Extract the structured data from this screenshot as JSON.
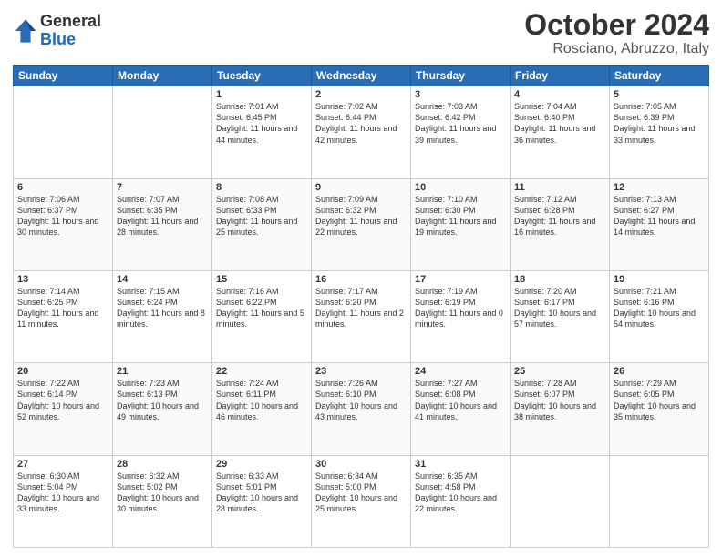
{
  "logo": {
    "general": "General",
    "blue": "Blue"
  },
  "header": {
    "month": "October 2024",
    "location": "Rosciano, Abruzzo, Italy"
  },
  "weekdays": [
    "Sunday",
    "Monday",
    "Tuesday",
    "Wednesday",
    "Thursday",
    "Friday",
    "Saturday"
  ],
  "weeks": [
    [
      {
        "day": "",
        "empty": true
      },
      {
        "day": "",
        "empty": true
      },
      {
        "day": "1",
        "sunrise": "Sunrise: 7:01 AM",
        "sunset": "Sunset: 6:45 PM",
        "daylight": "Daylight: 11 hours and 44 minutes."
      },
      {
        "day": "2",
        "sunrise": "Sunrise: 7:02 AM",
        "sunset": "Sunset: 6:44 PM",
        "daylight": "Daylight: 11 hours and 42 minutes."
      },
      {
        "day": "3",
        "sunrise": "Sunrise: 7:03 AM",
        "sunset": "Sunset: 6:42 PM",
        "daylight": "Daylight: 11 hours and 39 minutes."
      },
      {
        "day": "4",
        "sunrise": "Sunrise: 7:04 AM",
        "sunset": "Sunset: 6:40 PM",
        "daylight": "Daylight: 11 hours and 36 minutes."
      },
      {
        "day": "5",
        "sunrise": "Sunrise: 7:05 AM",
        "sunset": "Sunset: 6:39 PM",
        "daylight": "Daylight: 11 hours and 33 minutes."
      }
    ],
    [
      {
        "day": "6",
        "sunrise": "Sunrise: 7:06 AM",
        "sunset": "Sunset: 6:37 PM",
        "daylight": "Daylight: 11 hours and 30 minutes."
      },
      {
        "day": "7",
        "sunrise": "Sunrise: 7:07 AM",
        "sunset": "Sunset: 6:35 PM",
        "daylight": "Daylight: 11 hours and 28 minutes."
      },
      {
        "day": "8",
        "sunrise": "Sunrise: 7:08 AM",
        "sunset": "Sunset: 6:33 PM",
        "daylight": "Daylight: 11 hours and 25 minutes."
      },
      {
        "day": "9",
        "sunrise": "Sunrise: 7:09 AM",
        "sunset": "Sunset: 6:32 PM",
        "daylight": "Daylight: 11 hours and 22 minutes."
      },
      {
        "day": "10",
        "sunrise": "Sunrise: 7:10 AM",
        "sunset": "Sunset: 6:30 PM",
        "daylight": "Daylight: 11 hours and 19 minutes."
      },
      {
        "day": "11",
        "sunrise": "Sunrise: 7:12 AM",
        "sunset": "Sunset: 6:28 PM",
        "daylight": "Daylight: 11 hours and 16 minutes."
      },
      {
        "day": "12",
        "sunrise": "Sunrise: 7:13 AM",
        "sunset": "Sunset: 6:27 PM",
        "daylight": "Daylight: 11 hours and 14 minutes."
      }
    ],
    [
      {
        "day": "13",
        "sunrise": "Sunrise: 7:14 AM",
        "sunset": "Sunset: 6:25 PM",
        "daylight": "Daylight: 11 hours and 11 minutes."
      },
      {
        "day": "14",
        "sunrise": "Sunrise: 7:15 AM",
        "sunset": "Sunset: 6:24 PM",
        "daylight": "Daylight: 11 hours and 8 minutes."
      },
      {
        "day": "15",
        "sunrise": "Sunrise: 7:16 AM",
        "sunset": "Sunset: 6:22 PM",
        "daylight": "Daylight: 11 hours and 5 minutes."
      },
      {
        "day": "16",
        "sunrise": "Sunrise: 7:17 AM",
        "sunset": "Sunset: 6:20 PM",
        "daylight": "Daylight: 11 hours and 2 minutes."
      },
      {
        "day": "17",
        "sunrise": "Sunrise: 7:19 AM",
        "sunset": "Sunset: 6:19 PM",
        "daylight": "Daylight: 11 hours and 0 minutes."
      },
      {
        "day": "18",
        "sunrise": "Sunrise: 7:20 AM",
        "sunset": "Sunset: 6:17 PM",
        "daylight": "Daylight: 10 hours and 57 minutes."
      },
      {
        "day": "19",
        "sunrise": "Sunrise: 7:21 AM",
        "sunset": "Sunset: 6:16 PM",
        "daylight": "Daylight: 10 hours and 54 minutes."
      }
    ],
    [
      {
        "day": "20",
        "sunrise": "Sunrise: 7:22 AM",
        "sunset": "Sunset: 6:14 PM",
        "daylight": "Daylight: 10 hours and 52 minutes."
      },
      {
        "day": "21",
        "sunrise": "Sunrise: 7:23 AM",
        "sunset": "Sunset: 6:13 PM",
        "daylight": "Daylight: 10 hours and 49 minutes."
      },
      {
        "day": "22",
        "sunrise": "Sunrise: 7:24 AM",
        "sunset": "Sunset: 6:11 PM",
        "daylight": "Daylight: 10 hours and 46 minutes."
      },
      {
        "day": "23",
        "sunrise": "Sunrise: 7:26 AM",
        "sunset": "Sunset: 6:10 PM",
        "daylight": "Daylight: 10 hours and 43 minutes."
      },
      {
        "day": "24",
        "sunrise": "Sunrise: 7:27 AM",
        "sunset": "Sunset: 6:08 PM",
        "daylight": "Daylight: 10 hours and 41 minutes."
      },
      {
        "day": "25",
        "sunrise": "Sunrise: 7:28 AM",
        "sunset": "Sunset: 6:07 PM",
        "daylight": "Daylight: 10 hours and 38 minutes."
      },
      {
        "day": "26",
        "sunrise": "Sunrise: 7:29 AM",
        "sunset": "Sunset: 6:05 PM",
        "daylight": "Daylight: 10 hours and 35 minutes."
      }
    ],
    [
      {
        "day": "27",
        "sunrise": "Sunrise: 6:30 AM",
        "sunset": "Sunset: 5:04 PM",
        "daylight": "Daylight: 10 hours and 33 minutes."
      },
      {
        "day": "28",
        "sunrise": "Sunrise: 6:32 AM",
        "sunset": "Sunset: 5:02 PM",
        "daylight": "Daylight: 10 hours and 30 minutes."
      },
      {
        "day": "29",
        "sunrise": "Sunrise: 6:33 AM",
        "sunset": "Sunset: 5:01 PM",
        "daylight": "Daylight: 10 hours and 28 minutes."
      },
      {
        "day": "30",
        "sunrise": "Sunrise: 6:34 AM",
        "sunset": "Sunset: 5:00 PM",
        "daylight": "Daylight: 10 hours and 25 minutes."
      },
      {
        "day": "31",
        "sunrise": "Sunrise: 6:35 AM",
        "sunset": "Sunset: 4:58 PM",
        "daylight": "Daylight: 10 hours and 22 minutes."
      },
      {
        "day": "",
        "empty": true
      },
      {
        "day": "",
        "empty": true
      }
    ]
  ]
}
